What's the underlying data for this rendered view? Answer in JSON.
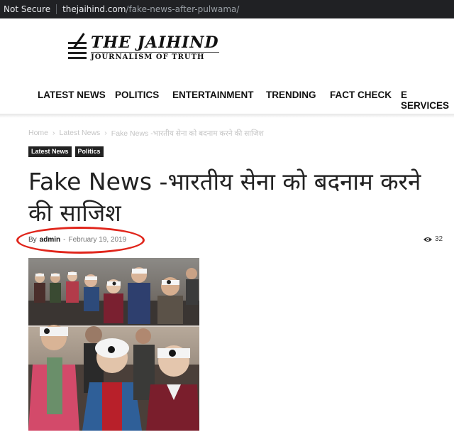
{
  "browser": {
    "security_label": "Not Secure",
    "host": "thejaihind.com",
    "path": "/fake-news-after-pulwama/"
  },
  "site": {
    "name": "THE JAIHIND",
    "tagline": "JOURNALISM OF TRUTH"
  },
  "nav": {
    "items": [
      "LATEST NEWS",
      "POLITICS",
      "ENTERTAINMENT",
      "TRENDING",
      "FACT CHECK",
      "E SERVICES"
    ]
  },
  "breadcrumb": {
    "items": [
      "Home",
      "Latest News",
      "Fake News -भारतीय सेना को बदनाम करने की साजिश"
    ],
    "separator": "›"
  },
  "article": {
    "categories": [
      "Latest News",
      "Politics"
    ],
    "title_line1": "Fake News -भारतीय सेना को बदनाम करने",
    "title_line2": "की साजिश",
    "by_label": "By",
    "author": "admin",
    "meta_separator": "-",
    "date": "February 19, 2019",
    "views": "32",
    "image_icon": "photo-of-children-with-bandaged-eyes"
  },
  "colors": {
    "address_bar": "#202124",
    "annotation_circle": "#e0251b",
    "category_badge": "#222222"
  }
}
